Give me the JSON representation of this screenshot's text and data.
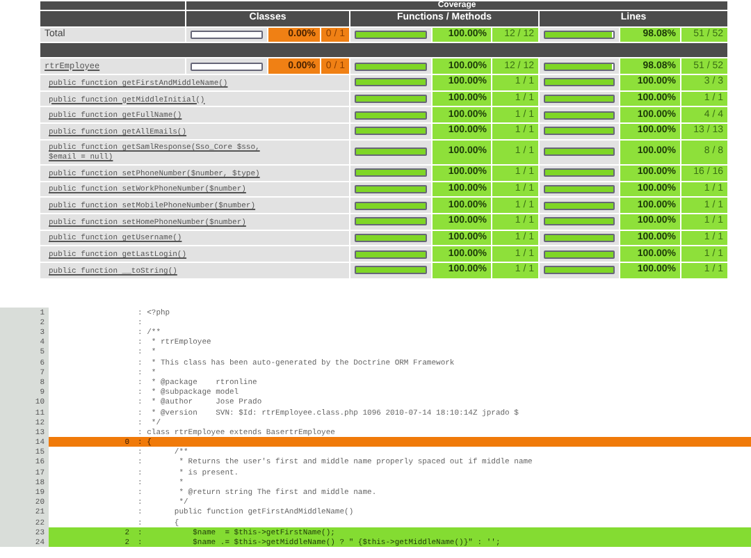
{
  "coverage": {
    "title": "Coverage",
    "columns": [
      "Classes",
      "Functions / Methods",
      "Lines"
    ],
    "total": {
      "name": "Total",
      "metrics": [
        {
          "level": 0,
          "percent": "0.00%",
          "count": "0 / 1"
        },
        {
          "level": 1,
          "percent": "100.00%",
          "count": "12 / 12"
        },
        {
          "level": 0.98,
          "percent": "98.08%",
          "count": "51 / 52"
        }
      ]
    },
    "rows": [
      {
        "kind": "class",
        "name": "rtrEmployee",
        "metrics": [
          {
            "level": 0,
            "percent": "0.00%",
            "count": "0 / 1"
          },
          {
            "level": 1,
            "percent": "100.00%",
            "count": "12 / 12"
          },
          {
            "level": 0.98,
            "percent": "98.08%",
            "count": "51 / 52"
          }
        ]
      },
      {
        "kind": "method",
        "name": "public function getFirstAndMiddleName()",
        "metrics": [
          {
            "level": 1,
            "percent": "100.00%",
            "count": "1 / 1"
          },
          {
            "level": 1,
            "percent": "100.00%",
            "count": "3 / 3"
          }
        ]
      },
      {
        "kind": "method",
        "name": "public function getMiddleInitial()",
        "metrics": [
          {
            "level": 1,
            "percent": "100.00%",
            "count": "1 / 1"
          },
          {
            "level": 1,
            "percent": "100.00%",
            "count": "1 / 1"
          }
        ]
      },
      {
        "kind": "method",
        "name": "public function getFullName()",
        "metrics": [
          {
            "level": 1,
            "percent": "100.00%",
            "count": "1 / 1"
          },
          {
            "level": 1,
            "percent": "100.00%",
            "count": "4 / 4"
          }
        ]
      },
      {
        "kind": "method",
        "name": "public function getAllEmails()",
        "metrics": [
          {
            "level": 1,
            "percent": "100.00%",
            "count": "1 / 1"
          },
          {
            "level": 1,
            "percent": "100.00%",
            "count": "13 / 13"
          }
        ]
      },
      {
        "kind": "method",
        "name": "public function getSamlResponse(Sso_Core $sso, $email = null)",
        "metrics": [
          {
            "level": 1,
            "percent": "100.00%",
            "count": "1 / 1"
          },
          {
            "level": 1,
            "percent": "100.00%",
            "count": "8 / 8"
          }
        ]
      },
      {
        "kind": "method",
        "name": "public function setPhoneNumber($number, $type)",
        "metrics": [
          {
            "level": 1,
            "percent": "100.00%",
            "count": "1 / 1"
          },
          {
            "level": 1,
            "percent": "100.00%",
            "count": "16 / 16"
          }
        ]
      },
      {
        "kind": "method",
        "name": "public function setWorkPhoneNumber($number)",
        "metrics": [
          {
            "level": 1,
            "percent": "100.00%",
            "count": "1 / 1"
          },
          {
            "level": 1,
            "percent": "100.00%",
            "count": "1 / 1"
          }
        ]
      },
      {
        "kind": "method",
        "name": "public function setMobilePhoneNumber($number)",
        "metrics": [
          {
            "level": 1,
            "percent": "100.00%",
            "count": "1 / 1"
          },
          {
            "level": 1,
            "percent": "100.00%",
            "count": "1 / 1"
          }
        ]
      },
      {
        "kind": "method",
        "name": "public function setHomePhoneNumber($number)",
        "metrics": [
          {
            "level": 1,
            "percent": "100.00%",
            "count": "1 / 1"
          },
          {
            "level": 1,
            "percent": "100.00%",
            "count": "1 / 1"
          }
        ]
      },
      {
        "kind": "method",
        "name": "public function getUsername()",
        "metrics": [
          {
            "level": 1,
            "percent": "100.00%",
            "count": "1 / 1"
          },
          {
            "level": 1,
            "percent": "100.00%",
            "count": "1 / 1"
          }
        ]
      },
      {
        "kind": "method",
        "name": "public function getLastLogin()",
        "metrics": [
          {
            "level": 1,
            "percent": "100.00%",
            "count": "1 / 1"
          },
          {
            "level": 1,
            "percent": "100.00%",
            "count": "1 / 1"
          }
        ]
      },
      {
        "kind": "method",
        "name": "public function __toString()",
        "metrics": [
          {
            "level": 1,
            "percent": "100.00%",
            "count": "1 / 1"
          },
          {
            "level": 1,
            "percent": "100.00%",
            "count": "1 / 1"
          }
        ]
      }
    ]
  },
  "source": [
    {
      "number": "1",
      "text": ": <?php",
      "kind": "plain"
    },
    {
      "number": "2",
      "text": ":",
      "kind": "plain"
    },
    {
      "number": "3",
      "text": ": /**",
      "kind": "plain"
    },
    {
      "number": "4",
      "text": ":  * rtrEmployee",
      "kind": "plain"
    },
    {
      "number": "5",
      "text": ":  *",
      "kind": "plain"
    },
    {
      "number": "6",
      "text": ":  * This class has been auto-generated by the Doctrine ORM Framework",
      "kind": "plain"
    },
    {
      "number": "7",
      "text": ":  *",
      "kind": "plain"
    },
    {
      "number": "8",
      "text": ":  * @package    rtronline",
      "kind": "plain"
    },
    {
      "number": "9",
      "text": ":  * @subpackage model",
      "kind": "plain"
    },
    {
      "number": "10",
      "text": ":  * @author     Jose Prado",
      "kind": "plain"
    },
    {
      "number": "11",
      "text": ":  * @version    SVN: $Id: rtrEmployee.class.php 1096 2010-07-14 18:10:14Z jprado $",
      "kind": "plain"
    },
    {
      "number": "12",
      "text": ":  */",
      "kind": "plain"
    },
    {
      "number": "13",
      "text": ": class rtrEmployee extends BasertrEmployee",
      "kind": "plain"
    },
    {
      "number": "14",
      "hits": "0",
      "text": ": {",
      "kind": "uncovered"
    },
    {
      "number": "15",
      "text": ":       /**",
      "kind": "plain"
    },
    {
      "number": "16",
      "text": ":        * Returns the user's first and middle name properly spaced out if middle name",
      "kind": "plain"
    },
    {
      "number": "17",
      "text": ":        * is present.",
      "kind": "plain"
    },
    {
      "number": "18",
      "text": ":        *",
      "kind": "plain"
    },
    {
      "number": "19",
      "text": ":        * @return string The first and middle name.",
      "kind": "plain"
    },
    {
      "number": "20",
      "text": ":        */",
      "kind": "plain"
    },
    {
      "number": "21",
      "text": ":       public function getFirstAndMiddleName()",
      "kind": "plain"
    },
    {
      "number": "22",
      "text": ":       {",
      "kind": "plain"
    },
    {
      "number": "23",
      "hits": "2",
      "text": ":           $name  = $this->getFirstName();",
      "kind": "covered"
    },
    {
      "number": "24",
      "hits": "2",
      "text": ":           $name .= $this->getMiddleName() ? \" {$this->getMiddleName()}\" : '';",
      "kind": "covered"
    }
  ]
}
